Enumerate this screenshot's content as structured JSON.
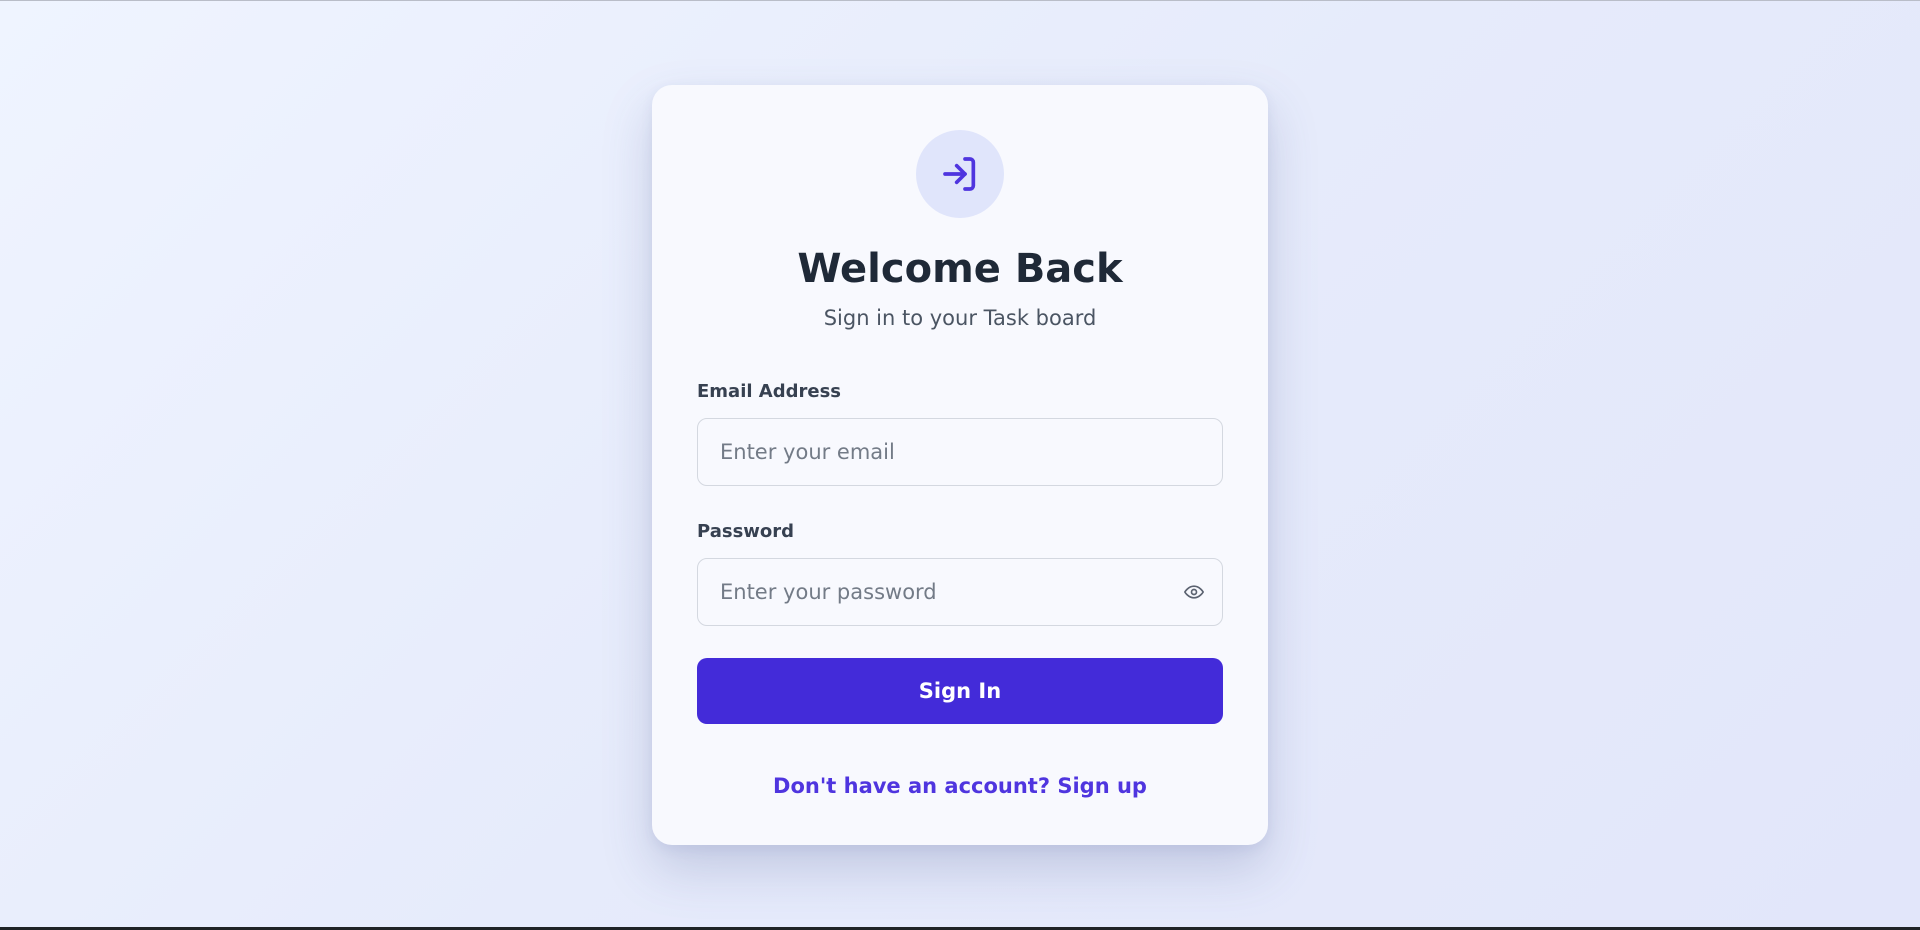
{
  "login": {
    "icon": "login-icon",
    "title": "Welcome Back",
    "subtitle": "Sign in to your Task board",
    "email": {
      "label": "Email Address",
      "placeholder": "Enter your email",
      "value": ""
    },
    "password": {
      "label": "Password",
      "placeholder": "Enter your password",
      "value": "",
      "toggle_icon": "eye-icon"
    },
    "submit_label": "Sign In",
    "signup_link": "Don't have an account? Sign up"
  },
  "colors": {
    "accent": "#432bd9",
    "link": "#4f35df",
    "icon_bg": "#e0e5fb",
    "card_bg": "#f8f9fe",
    "title": "#1f2937"
  }
}
